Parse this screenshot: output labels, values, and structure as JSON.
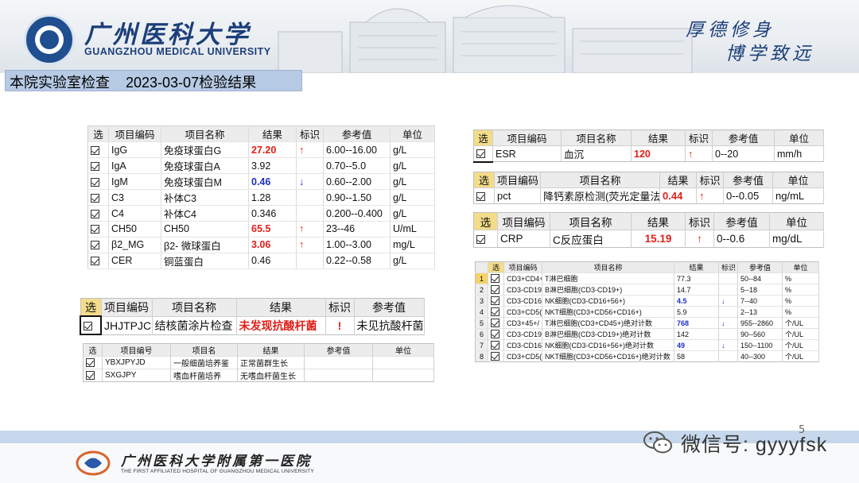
{
  "header": {
    "university_cn": "广州医科大学",
    "university_en": "GUANGZHOU MEDICAL UNIVERSITY",
    "motto_line1": "厚德修身",
    "motto_line2": "博学致远"
  },
  "title": "本院实验室检查    2023-03-07检验结果",
  "table_immunology": {
    "headers": [
      "选",
      "项目编码",
      "项目名称",
      "结果",
      "标识",
      "参考值",
      "单位"
    ],
    "rows": [
      {
        "code": "IgG",
        "name": "免疫球蛋白G",
        "result": "27.20",
        "flag": "↑",
        "ref": "6.00--16.00",
        "unit": "g/L",
        "style": "red",
        "flagstyle": "up"
      },
      {
        "code": "IgA",
        "name": "免疫球蛋白A",
        "result": "3.92",
        "flag": "",
        "ref": "0.70--5.0",
        "unit": "g/L",
        "style": "",
        "flagstyle": ""
      },
      {
        "code": "IgM",
        "name": "免疫球蛋白M",
        "result": "0.46",
        "flag": "↓",
        "ref": "0.60--2.00",
        "unit": "g/L",
        "style": "blue",
        "flagstyle": "down"
      },
      {
        "code": "C3",
        "name": "补体C3",
        "result": "1.28",
        "flag": "",
        "ref": "0.90--1.50",
        "unit": "g/L",
        "style": "",
        "flagstyle": ""
      },
      {
        "code": "C4",
        "name": "补体C4",
        "result": "0.346",
        "flag": "",
        "ref": "0.200--0.400",
        "unit": "g/L",
        "style": "",
        "flagstyle": ""
      },
      {
        "code": "CH50",
        "name": "CH50",
        "result": "65.5",
        "flag": "↑",
        "ref": "23--46",
        "unit": "U/mL",
        "style": "red",
        "flagstyle": "up"
      },
      {
        "code": "β2_MG",
        "name": "β2- 微球蛋白",
        "result": "3.06",
        "flag": "↑",
        "ref": "1.00--3.00",
        "unit": "mg/L",
        "style": "red",
        "flagstyle": "up"
      },
      {
        "code": "CER",
        "name": "铜蓝蛋白",
        "result": "0.46",
        "flag": "",
        "ref": "0.22--0.58",
        "unit": "g/L",
        "style": "",
        "flagstyle": ""
      }
    ]
  },
  "table_tb": {
    "headers": [
      "选",
      "项目编码",
      "项目名称",
      "结果",
      "标识",
      "参考值"
    ],
    "row": {
      "code": "JHJTPJC",
      "name": "结核菌涂片检查",
      "result": "未发现抗酸杆菌",
      "flag": "!",
      "ref": "未见抗酸杆菌"
    }
  },
  "table_culture": {
    "headers": [
      "选",
      "项目编号",
      "项目名",
      "结果",
      "参考值",
      "单位"
    ],
    "rows": [
      {
        "code": "YBXJPYJD",
        "name": "一般细菌培养鉴",
        "result": "正常菌群生长"
      },
      {
        "code": "SXGJPY",
        "name": "嗜血杆菌培养",
        "result": "无嗜血杆菌生长"
      }
    ]
  },
  "table_esr": {
    "headers": [
      "选",
      "项目编码",
      "项目名称",
      "结果",
      "标识",
      "参考值",
      "单位"
    ],
    "row": {
      "code": "ESR",
      "name": "血沉",
      "result": "120",
      "flag": "↑",
      "ref": "0--20",
      "unit": "mm/h"
    }
  },
  "table_pct": {
    "headers": [
      "选",
      "项目编码",
      "项目名称",
      "结果",
      "标识",
      "参考值",
      "单位"
    ],
    "row": {
      "code": "pct",
      "name": "降钙素原检测(荧光定量法)",
      "result": "0.44",
      "flag": "↑",
      "ref": "0--0.05",
      "unit": "ng/mL"
    }
  },
  "table_crp": {
    "headers": [
      "选",
      "项目编码",
      "项目名称",
      "结果",
      "标识",
      "参考值",
      "单位"
    ],
    "row": {
      "code": "CRP",
      "name": "C反应蛋白",
      "result": "15.19",
      "flag": "↑",
      "ref": "0--0.6",
      "unit": "mg/dL"
    }
  },
  "table_lymph": {
    "headers": [
      "",
      "选",
      "项目编码",
      "项目名称",
      "结果",
      "标识",
      "参考值",
      "单位"
    ],
    "rows": [
      {
        "n": "1",
        "code": "CD3+CD4+",
        "name": "T淋巴细胞",
        "result": "77.3",
        "flag": "",
        "ref": "50--84",
        "unit": "%",
        "style": ""
      },
      {
        "n": "2",
        "code": "CD3-CD19",
        "name": "B淋巴细胞(CD3-CD19+)",
        "result": "14.7",
        "flag": "",
        "ref": "5--18",
        "unit": "%",
        "style": ""
      },
      {
        "n": "3",
        "code": "CD3-CD16",
        "name": "NK细胞(CD3-CD16+56+)",
        "result": "4.5",
        "flag": "↓",
        "ref": "7--40",
        "unit": "%",
        "style": "blue"
      },
      {
        "n": "4",
        "code": "CD3+CD5(",
        "name": "NKT细胞(CD3+CD56+CD16+)",
        "result": "5.9",
        "flag": "",
        "ref": "2--13",
        "unit": "%",
        "style": ""
      },
      {
        "n": "5",
        "code": "CD3+45+/",
        "name": "T淋巴细胞(CD3+CD45+)绝对计数",
        "result": "768",
        "flag": "↓",
        "ref": "955--2860",
        "unit": "个/UL",
        "style": "blue"
      },
      {
        "n": "6",
        "code": "CD3-CD19",
        "name": "B淋巴细胞(CD3-CD19+)绝对计数",
        "result": "142",
        "flag": "",
        "ref": "90--560",
        "unit": "个/UL",
        "style": ""
      },
      {
        "n": "7",
        "code": "CD3-CD16",
        "name": "NK细胞(CD3-CD16+56+)绝对计数",
        "result": "49",
        "flag": "↓",
        "ref": "150--1100",
        "unit": "个/UL",
        "style": "blue"
      },
      {
        "n": "8",
        "code": "CD3+CD5(",
        "name": "NKT细胞(CD3+CD56+CD16+)绝对计数",
        "result": "58",
        "flag": "",
        "ref": "40--300",
        "unit": "个/UL",
        "style": ""
      }
    ]
  },
  "footer": {
    "hospital_cn": "广州医科大学附属第一医院",
    "hospital_en": "THE FIRST AFFILIATED HOSPITAL OF GUANGZHOU MEDICAL UNIVERSITY",
    "page_number": "5",
    "wechat": "微信号: gyyyfsk"
  }
}
